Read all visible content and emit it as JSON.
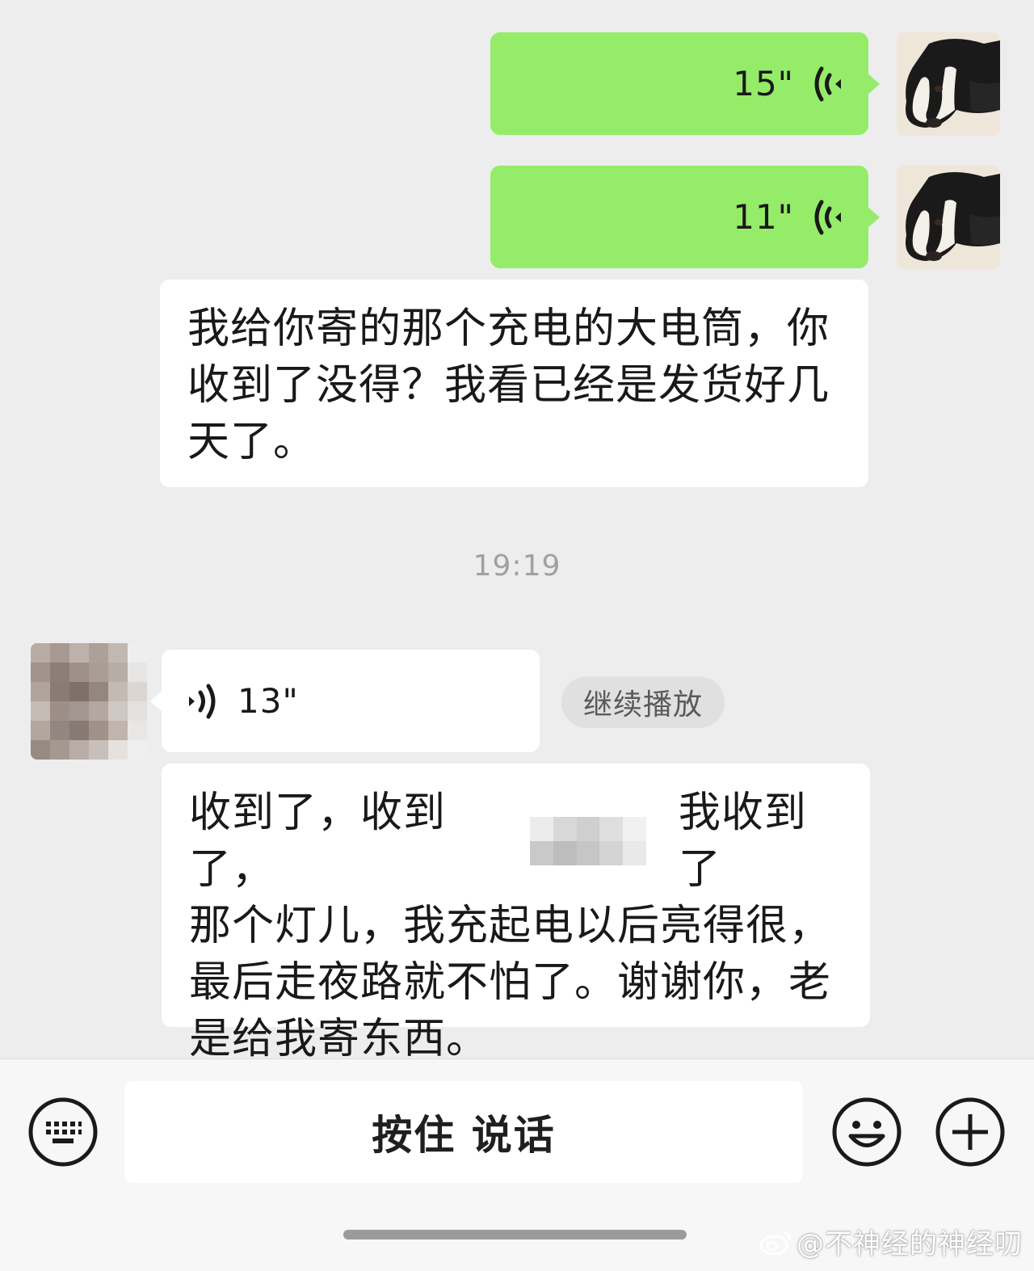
{
  "messages": [
    {
      "type": "voice",
      "side": "right",
      "duration": "15\""
    },
    {
      "type": "voice",
      "side": "right",
      "duration": "11\""
    },
    {
      "type": "text",
      "side": "right",
      "lines": [
        "我给你寄的那个充电的大电筒，你",
        "收到了没得？我看已经是发货好几",
        "天了。"
      ]
    },
    {
      "type": "time",
      "text": "19:19"
    },
    {
      "type": "voice",
      "side": "left",
      "duration": "13\"",
      "continue_label": "继续播放"
    },
    {
      "type": "text",
      "side": "left",
      "lines_first": [
        "收到了，收到了，",
        "我收到了"
      ],
      "lines": [
        "那个灯儿，我充起电以后亮得很，",
        "最后走夜路就不怕了。谢谢你，老",
        "是给我寄东西。"
      ]
    }
  ],
  "input_bar": {
    "hold_to_talk": "按住 说话",
    "left_icon": "keyboard-icon",
    "emoji_icon": "emoji-icon",
    "plus_icon": "plus-icon"
  },
  "watermark": "@不神经的神经叨",
  "colors": {
    "background": "#ededed",
    "self_bubble": "#95ec69",
    "other_bubble": "#ffffff",
    "input_bar": "#f7f7f7"
  }
}
